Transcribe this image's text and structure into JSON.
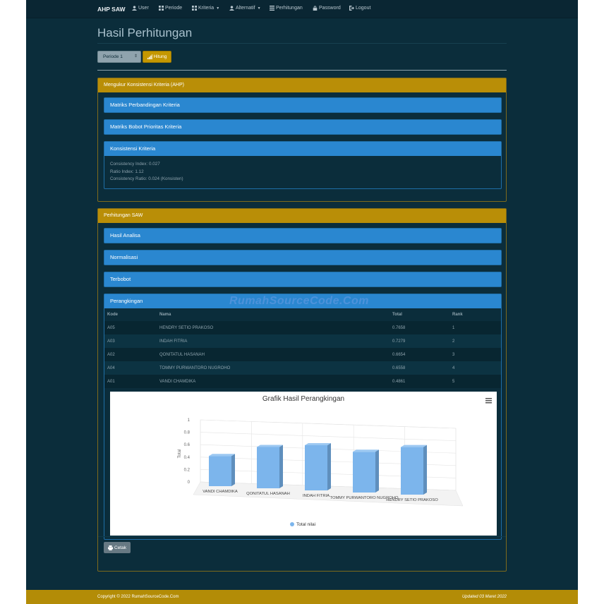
{
  "navbar": {
    "brand": "AHP SAW",
    "items": [
      {
        "label": "User",
        "icon": "user-icon",
        "dropdown": false
      },
      {
        "label": "Periode",
        "icon": "grid-icon",
        "dropdown": false
      },
      {
        "label": "Kriteria",
        "icon": "grid-icon",
        "dropdown": true
      },
      {
        "label": "Alternatif",
        "icon": "user-icon",
        "dropdown": true
      },
      {
        "label": "Perhitungan",
        "icon": "list-icon",
        "dropdown": false
      },
      {
        "label": "Password",
        "icon": "lock-icon",
        "dropdown": false
      },
      {
        "label": "Logout",
        "icon": "logout-icon",
        "dropdown": false
      }
    ]
  },
  "page": {
    "title": "Hasil Perhitungan",
    "periode_selected": "Periode 1",
    "hitung_label": "Hitung"
  },
  "ahp_panel": {
    "heading": "Mengukur Konsistensi Kriteria (AHP)",
    "matriks_perbandingan": "Matriks Perbandingan Kriteria",
    "matriks_bobot": "Matriks Bobot Prioritas Kriteria",
    "konsistensi_heading": "Konsistensi Kriteria",
    "ci": "Consistency Index: 0.027",
    "ri": "Ratio Index: 1.12",
    "cr": "Consistency Ratio: 0.024 (Konsisten)"
  },
  "saw_panel": {
    "heading": "Perhitungan SAW",
    "hasil_analisa": "Hasil Analisa",
    "normalisasi": "Normalisasi",
    "terbobot": "Terbobot",
    "perangkingan": "Perangkingan",
    "columns": {
      "kode": "Kode",
      "nama": "Nama",
      "total": "Total",
      "rank": "Rank"
    },
    "rows": [
      {
        "kode": "A05",
        "nama": "HENDRY SETIO PRAKOSO",
        "total": "0.7658",
        "rank": "1"
      },
      {
        "kode": "A03",
        "nama": "INDAH FITRIA",
        "total": "0.7279",
        "rank": "2"
      },
      {
        "kode": "A02",
        "nama": "QONITATUL HASANAH",
        "total": "0.6654",
        "rank": "3"
      },
      {
        "kode": "A04",
        "nama": "TOMMY PURWANTORO NUGROHO",
        "total": "0.6558",
        "rank": "4"
      },
      {
        "kode": "A01",
        "nama": "VANDI CHAMDIKA",
        "total": "0.4861",
        "rank": "5"
      }
    ],
    "cetak_label": "Cetak"
  },
  "chart_data": {
    "type": "bar",
    "title": "Grafik Hasil Perangkingan",
    "ylabel": "Total",
    "ylim": [
      0,
      1
    ],
    "yticks": [
      "0",
      "0.2",
      "0.4",
      "0.6",
      "0.8",
      "1"
    ],
    "categories": [
      "VANDI CHAMDIKA",
      "QONITATUL HASANAH",
      "INDAH FITRIA",
      "TOMMY PURWANTORO NUGROHO",
      "HENDRY SETIO PRAKOSO"
    ],
    "series": [
      {
        "name": "Total nilai",
        "values": [
          0.4861,
          0.6654,
          0.7279,
          0.6558,
          0.7658
        ]
      }
    ],
    "legend_position": "bottom-center",
    "bar_color": "#7cb5ec",
    "three_d": true
  },
  "watermark": "RumahSourceCode.Com",
  "footer": {
    "copyright": "Copyright © 2022 RumahSourceCode.Com",
    "updated": "Updated 03 Maret 2022"
  }
}
